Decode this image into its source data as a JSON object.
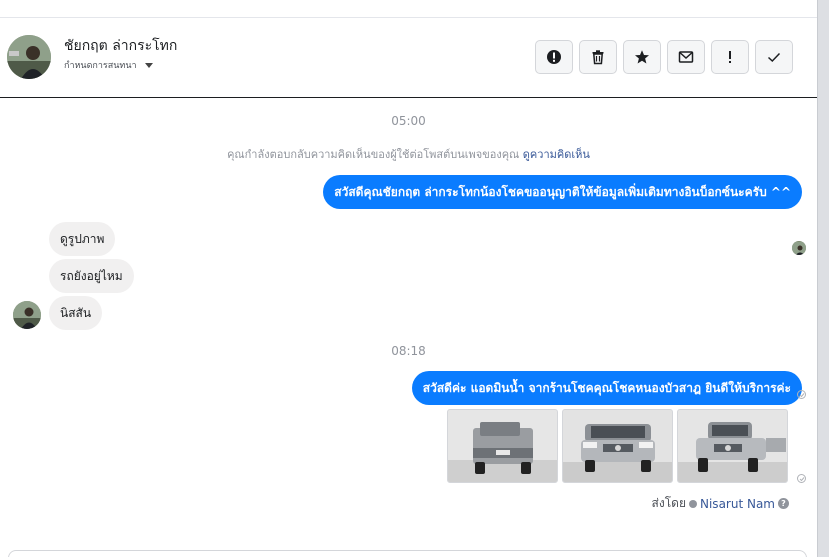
{
  "header": {
    "contact_name": "ชัยกฤต ล่ากระโทก",
    "subtitle": "กำหนดการสนทนา"
  },
  "actions": [
    {
      "icon": "alert-circle-icon",
      "name": "spam-button"
    },
    {
      "icon": "trash-icon",
      "name": "delete-button"
    },
    {
      "icon": "star-icon",
      "name": "star-button"
    },
    {
      "icon": "envelope-icon",
      "name": "mark-unread-button"
    },
    {
      "icon": "exclamation-icon",
      "name": "follow-up-button"
    },
    {
      "icon": "check-icon",
      "name": "done-button"
    }
  ],
  "conversation": {
    "time_1": "05:00",
    "notice_text": "คุณกำลังตอบกลับความคิดเห็นของผู้ใช้ต่อโพสต์บนเพจของคุณ",
    "notice_link": "ดูความคิดเห็น",
    "outgoing_1": "สวัสดีคุณชัยกฤต ล่ากระโทกน้องโชคขออนุญาติให้ข้อมูลเพิ่มเติมทางอินบ็อกซ์นะครับ ^^",
    "incoming": [
      "ดูรูปภาพ",
      "รถยังอยู่ไหม",
      "นิสสัน"
    ],
    "time_2": "08:18",
    "outgoing_2": "สวัสดีค่ะ แอดมินน้ำ จากร้านโชคคุณโชคหนองบัวสาฎ ยินดีให้บริการค่ะ",
    "photos_count": 3,
    "sent_by_label": "ส่งโดย",
    "sent_by_name": "Nisarut Nam"
  },
  "colors": {
    "accent": "#0a7cff",
    "incoming_bubble": "#f1f0f0",
    "link": "#385898"
  }
}
